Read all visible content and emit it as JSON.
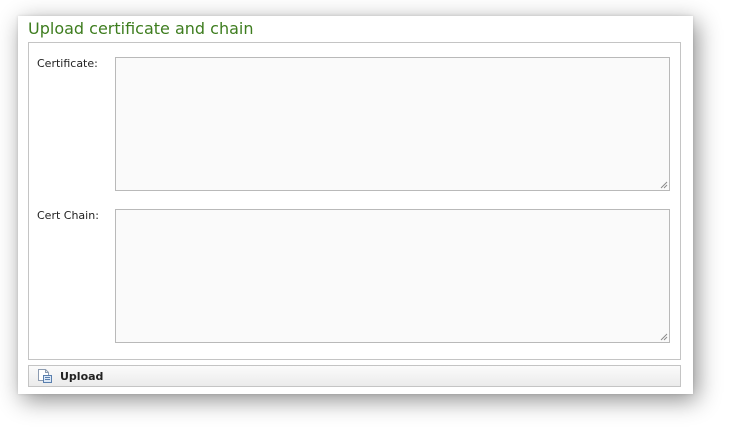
{
  "panel": {
    "title": "Upload certificate and chain"
  },
  "form": {
    "certificate": {
      "label": "Certificate:",
      "value": ""
    },
    "cert_chain": {
      "label": "Cert Chain:",
      "value": ""
    }
  },
  "toolbar": {
    "upload_label": "Upload",
    "upload_icon": "upload-document-icon"
  },
  "colors": {
    "title": "#3e7d1f",
    "border": "#c4c4c4",
    "textarea_bg": "#fafafa"
  }
}
